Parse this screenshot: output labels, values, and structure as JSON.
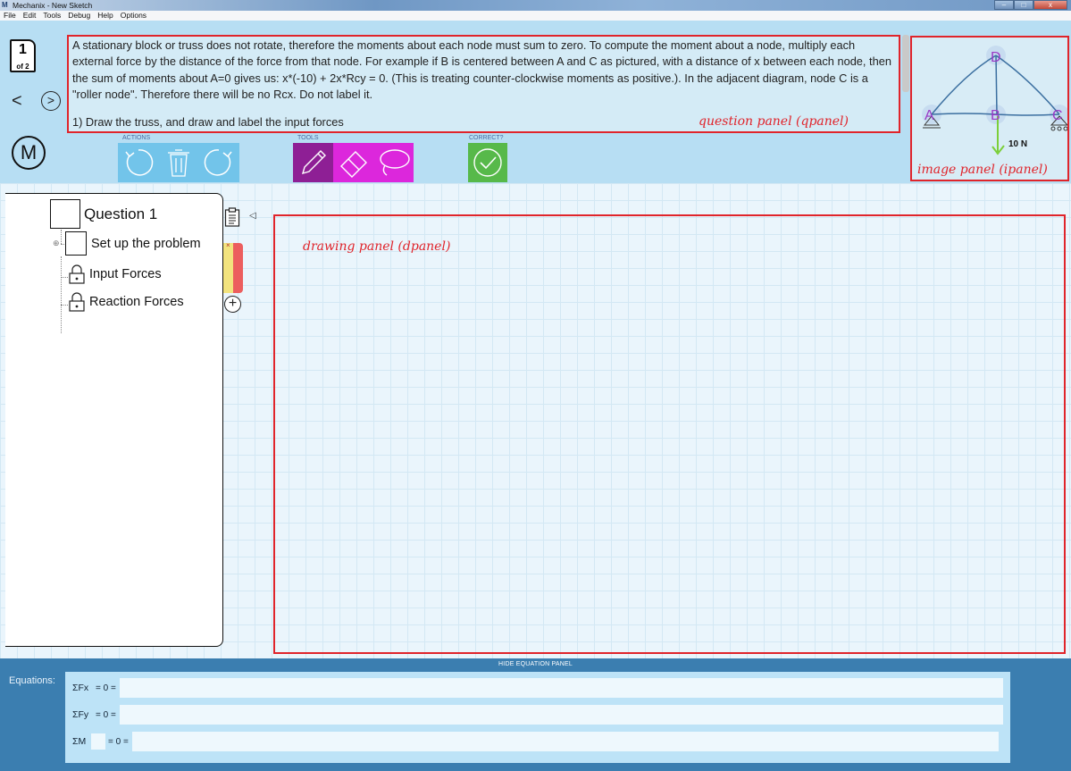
{
  "window": {
    "app_icon_label": "M",
    "title": "Mechanix - New Sketch",
    "min": "–",
    "max": "□",
    "close": "x"
  },
  "menu": {
    "items": [
      "File",
      "Edit",
      "Tools",
      "Debug",
      "Help",
      "Options"
    ]
  },
  "nav": {
    "page_number": "1",
    "page_of": "of 2",
    "prev_label": "<",
    "next_label": ">",
    "logo_label": "M"
  },
  "question_panel": {
    "text": "A stationary block or truss does not rotate, therefore the moments about each node must sum to zero. To compute the moment about a node, multiply each external force by the distance of the force from that node.  For example if B is centered between A and C as pictured, with a distance of x between each node, then the sum of moments about A=0 gives us: x*(-10) + 2x*Rcy = 0.  (This is treating counter-clockwise moments as positive.). In the adjacent diagram, node C is a \"roller node\". Therefore there will be no Rcx. Do not label it.",
    "step": "1) Draw the truss, and draw and label the input forces",
    "annotation": "question panel (qpanel)"
  },
  "image_panel": {
    "nodes": [
      "D",
      "A",
      "B",
      "C"
    ],
    "force_label": "10 N",
    "annotation": "image panel (ipanel)"
  },
  "toolbar": {
    "actions_label": "ACTIONS",
    "tools_label": "TOOLS",
    "correct_label": "CORRECT?"
  },
  "sidebar": {
    "question_title": "Question 1",
    "step_title": "Set up the problem",
    "substeps": [
      "Input Forces",
      "Reaction Forces"
    ],
    "status_x": "×",
    "collapse": "◁",
    "add": "+"
  },
  "drawing_panel": {
    "annotation": "drawing panel (dpanel)"
  },
  "equations": {
    "toggle_label": "HIDE EQUATION PANEL",
    "label": "Equations:",
    "fx_label": "ΣFx",
    "fy_label": "ΣFy",
    "m_label": "ΣM",
    "eq_suffix": "= 0 =",
    "fx_value": "",
    "fy_value": "",
    "m_value": ""
  },
  "colors": {
    "ribbon": "#b7def3",
    "annotation_red": "#e0242b",
    "actions_blue": "#72c4ea",
    "tools_purple": "#8e1f95",
    "tools_magenta": "#dc27dc",
    "correct_green": "#57b94a",
    "equation_panel": "#3b7eb0"
  }
}
